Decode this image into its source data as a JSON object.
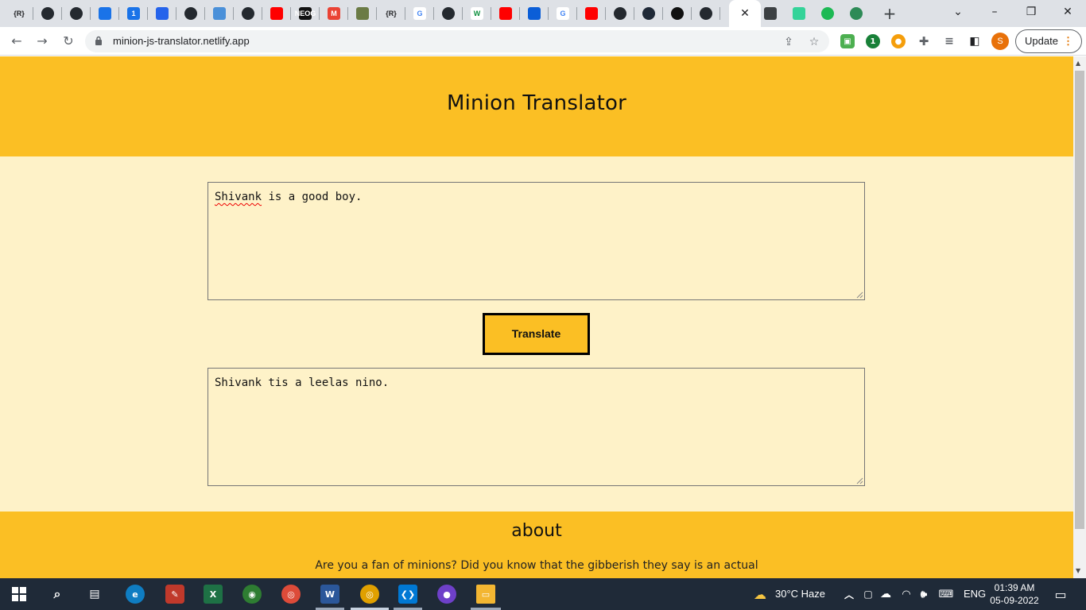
{
  "browser": {
    "url": "minion-js-translator.netlify.app",
    "update_label": "Update",
    "profile_initial": "S",
    "tabs": [
      {
        "icon": "r-bracket-icon",
        "text": "{R}",
        "color": "#dee1e6",
        "fg": "#202124"
      },
      {
        "icon": "github-icon",
        "text": "",
        "color": "#24292f"
      },
      {
        "icon": "github-icon",
        "text": "",
        "color": "#24292f"
      },
      {
        "icon": "power-icon",
        "text": "",
        "color": "#1a73e8"
      },
      {
        "icon": "gmail-badge-icon",
        "text": "1",
        "color": "#1a73e8"
      },
      {
        "icon": "diamond-icon",
        "text": "",
        "color": "#2563eb"
      },
      {
        "icon": "github-icon",
        "text": "",
        "color": "#24292f"
      },
      {
        "icon": "laptop-icon",
        "text": "",
        "color": "#4a90d9"
      },
      {
        "icon": "github-icon",
        "text": "",
        "color": "#24292f"
      },
      {
        "icon": "youtube-icon",
        "text": "",
        "color": "#ff0000"
      },
      {
        "icon": "neog-icon",
        "text": "NEOG",
        "color": "#111111"
      },
      {
        "icon": "gmail-icon",
        "text": "M",
        "color": "#ea4335"
      },
      {
        "icon": "image-icon",
        "text": "",
        "color": "#6b7b45"
      },
      {
        "icon": "r-bracket-icon",
        "text": "{R}",
        "color": "#dee1e6",
        "fg": "#202124"
      },
      {
        "icon": "google-icon",
        "text": "G",
        "color": "#ffffff",
        "fg": "#4285f4"
      },
      {
        "icon": "github-icon",
        "text": "",
        "color": "#24292f"
      },
      {
        "icon": "w-icon",
        "text": "W",
        "color": "#ffffff",
        "fg": "#0c8f3e"
      },
      {
        "icon": "youtube-icon",
        "text": "",
        "color": "#ff0000"
      },
      {
        "icon": "refresh-blue-icon",
        "text": "",
        "color": "#0b5ed7"
      },
      {
        "icon": "google-icon",
        "text": "G",
        "color": "#ffffff",
        "fg": "#4285f4"
      },
      {
        "icon": "youtube-icon",
        "text": "",
        "color": "#ff0000"
      },
      {
        "icon": "github-icon",
        "text": "",
        "color": "#24292f"
      },
      {
        "icon": "circle-dark-icon",
        "text": "",
        "color": "#1f2937"
      },
      {
        "icon": "octopus-icon",
        "text": "",
        "color": "#111111"
      },
      {
        "icon": "github-icon",
        "text": "",
        "color": "#24292f"
      }
    ],
    "after_tabs": [
      {
        "icon": "document-icon",
        "color": "#3c4043"
      },
      {
        "icon": "grid-green-icon",
        "color": "#34d399"
      },
      {
        "icon": "spotify-icon",
        "color": "#1db954"
      },
      {
        "icon": "globe-icon",
        "color": "#2e8b57"
      }
    ]
  },
  "app": {
    "title": "Minion Translator",
    "input_text_prefix": "Shivank",
    "input_text_rest": " is a good boy.",
    "translate_label": "Translate",
    "output_text": "Shivank tis a leelas nino.",
    "about_heading": "about",
    "about_text": "Are you a fan of minions? Did you know that the gibberish they say is an actual"
  },
  "taskbar": {
    "weather": "30°C  Haze",
    "lang": "ENG",
    "time": "01:39 AM",
    "date": "05-09-2022"
  }
}
